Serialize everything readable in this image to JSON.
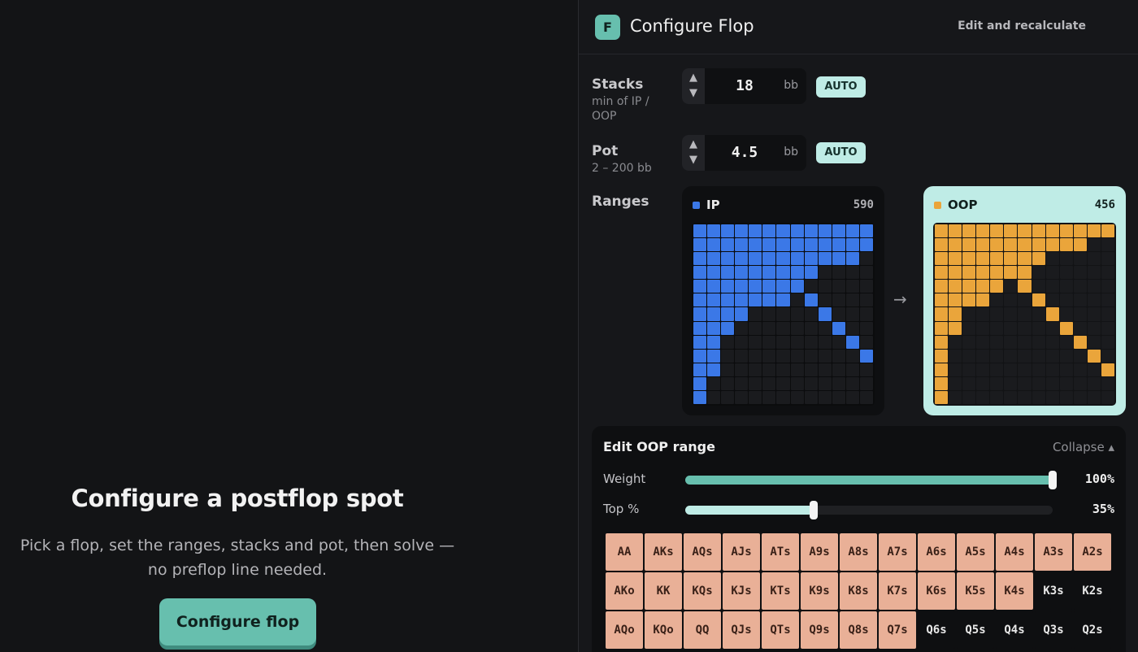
{
  "hero": {
    "title": "Configure a postflop spot",
    "subtitle": "Pick a flop, set the ranges, stacks and pot, then solve — no preflop line needed.",
    "button": "Configure flop"
  },
  "header": {
    "badge": "F",
    "title": "Configure Flop",
    "action": "Edit and recalculate"
  },
  "stacks": {
    "label": "Stacks",
    "hint": "min of IP / OOP",
    "value": "18",
    "unit": "bb",
    "auto": "AUTO"
  },
  "pot": {
    "label": "Pot",
    "hint": "2 – 200 bb",
    "value": "4.5",
    "unit": "bb",
    "auto": "AUTO"
  },
  "ranges": {
    "label": "Ranges",
    "arrow": "→",
    "ip": {
      "name": "IP",
      "count": "590",
      "color": "#3b78e7",
      "rows": [
        "1111111111111",
        "1111111111111",
        "1111111111110",
        "1111111110000",
        "1111111100000",
        "1111111010000",
        "1111000001000",
        "1110000000100",
        "1100000000010",
        "1100000000001",
        "1100000000000",
        "1000000000000",
        "1000000000000"
      ]
    },
    "oop": {
      "name": "OOP",
      "count": "456",
      "color": "#eaa53b",
      "rows": [
        "1111111111111",
        "1111111111100",
        "1111111100000",
        "1111111000000",
        "1111101000000",
        "1111000100000",
        "1100000010000",
        "1100000001000",
        "1000000000100",
        "1000000000010",
        "1000000000001",
        "1000000000000",
        "1000000000000"
      ]
    }
  },
  "edit": {
    "title": "Edit OOP range",
    "collapse": "Collapse ▴",
    "weight": {
      "label": "Weight",
      "value": "100%",
      "fraction": 1.0,
      "color": "#67bfae"
    },
    "top": {
      "label": "Top %",
      "value": "35%",
      "fraction": 0.35,
      "color": "#bfece6"
    },
    "hands": [
      {
        "h": "AA",
        "on": true
      },
      {
        "h": "AKs",
        "on": true
      },
      {
        "h": "AQs",
        "on": true
      },
      {
        "h": "AJs",
        "on": true
      },
      {
        "h": "ATs",
        "on": true
      },
      {
        "h": "A9s",
        "on": true
      },
      {
        "h": "A8s",
        "on": true
      },
      {
        "h": "A7s",
        "on": true
      },
      {
        "h": "A6s",
        "on": true
      },
      {
        "h": "A5s",
        "on": true
      },
      {
        "h": "A4s",
        "on": true
      },
      {
        "h": "A3s",
        "on": true
      },
      {
        "h": "A2s",
        "on": true
      },
      {
        "h": "AKo",
        "on": true
      },
      {
        "h": "KK",
        "on": true
      },
      {
        "h": "KQs",
        "on": true
      },
      {
        "h": "KJs",
        "on": true
      },
      {
        "h": "KTs",
        "on": true
      },
      {
        "h": "K9s",
        "on": true
      },
      {
        "h": "K8s",
        "on": true
      },
      {
        "h": "K7s",
        "on": true
      },
      {
        "h": "K6s",
        "on": true
      },
      {
        "h": "K5s",
        "on": true
      },
      {
        "h": "K4s",
        "on": true
      },
      {
        "h": "K3s",
        "on": false
      },
      {
        "h": "K2s",
        "on": false
      },
      {
        "h": "AQo",
        "on": true
      },
      {
        "h": "KQo",
        "on": true
      },
      {
        "h": "QQ",
        "on": true
      },
      {
        "h": "QJs",
        "on": true
      },
      {
        "h": "QTs",
        "on": true
      },
      {
        "h": "Q9s",
        "on": true
      },
      {
        "h": "Q8s",
        "on": true
      },
      {
        "h": "Q7s",
        "on": true
      },
      {
        "h": "Q6s",
        "on": false
      },
      {
        "h": "Q5s",
        "on": false
      },
      {
        "h": "Q4s",
        "on": false
      },
      {
        "h": "Q3s",
        "on": false
      },
      {
        "h": "Q2s",
        "on": false
      }
    ]
  }
}
